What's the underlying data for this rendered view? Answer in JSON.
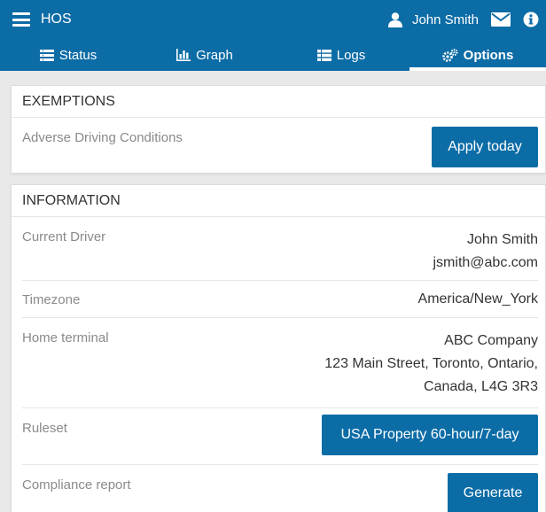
{
  "header": {
    "app_title": "HOS",
    "user_name": "John Smith",
    "icons": [
      "menu-icon",
      "user-icon",
      "mail-icon",
      "info-icon"
    ]
  },
  "tabs": [
    {
      "label": "Status",
      "icon": "list-icon",
      "active": false
    },
    {
      "label": "Graph",
      "icon": "bar-chart-icon",
      "active": false
    },
    {
      "label": "Logs",
      "icon": "list-icon",
      "active": false
    },
    {
      "label": "Options",
      "icon": "gears-icon",
      "active": true
    }
  ],
  "exemptions": {
    "title": "EXEMPTIONS",
    "adverse_label": "Adverse Driving Conditions",
    "apply_button": "Apply today"
  },
  "information": {
    "title": "INFORMATION",
    "current_driver_label": "Current Driver",
    "driver_name": "John Smith",
    "driver_email": "jsmith@abc.com",
    "timezone_label": "Timezone",
    "timezone_value": "America/New_York",
    "home_terminal_label": "Home terminal",
    "terminal_name": "ABC Company",
    "terminal_address_1": "123 Main Street, Toronto, Ontario,",
    "terminal_address_2": "Canada, L4G 3R3",
    "ruleset_label": "Ruleset",
    "ruleset_button": "USA Property 60-hour/7-day",
    "compliance_label": "Compliance report",
    "generate_button": "Generate"
  },
  "colors": {
    "brand": "#0c6ca6",
    "background": "#e9e9e9",
    "label_gray": "#8a8a8a"
  }
}
